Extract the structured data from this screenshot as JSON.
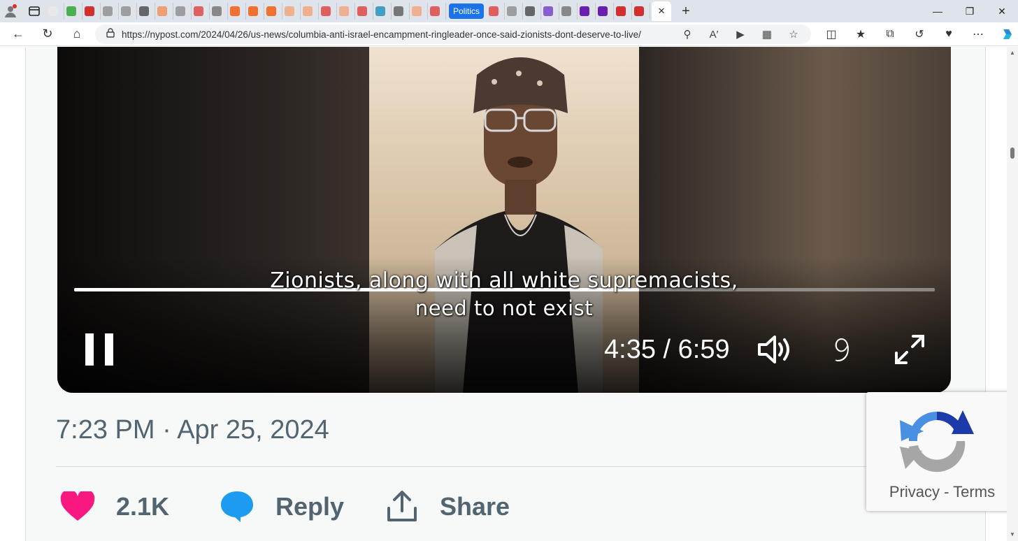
{
  "browser": {
    "tab_politics_label": "Politics",
    "active_tab_close": "✕",
    "new_tab": "+",
    "url": "https://nypost.com/2024/04/26/us-news/columbia-anti-israel-encampment-ringleader-once-said-zionists-dont-deserve-to-live/",
    "tab_favicons": [
      "#e8e8e8",
      "#4caf50",
      "#d32f2f",
      "#9e9e9e",
      "#9e9e9e",
      "#666666",
      "#f0a070",
      "#9e9e9e",
      "#e06060",
      "#888888",
      "#f07030",
      "#f07030",
      "#f07030",
      "#f0b090",
      "#f0b090",
      "#e06060",
      "#f0b090",
      "#e06060",
      "#40a0c0",
      "#777777",
      "#f0b090",
      "#e06060"
    ],
    "tab_favicons_after": [
      "#e06060",
      "#9e9e9e",
      "#666666",
      "#8a5cd0",
      "#888888",
      "#6a1fb0",
      "#6a1fb0",
      "#d32f2f",
      "#d32f2f"
    ]
  },
  "video": {
    "caption_line1": "Zionists, along with all white supremacists,",
    "caption_line2": "need to not exist",
    "time_display": "4:35 / 6:59",
    "progress_fraction": 0.656
  },
  "tweet": {
    "timestamp": "7:23 PM · Apr 25, 2024",
    "like_count": "2.1K",
    "reply_label": "Reply",
    "share_label": "Share",
    "like_color": "#f91880",
    "reply_color": "#1d9bf0",
    "muted_color": "#536471"
  },
  "recaptcha": {
    "links": "Privacy - Terms"
  }
}
